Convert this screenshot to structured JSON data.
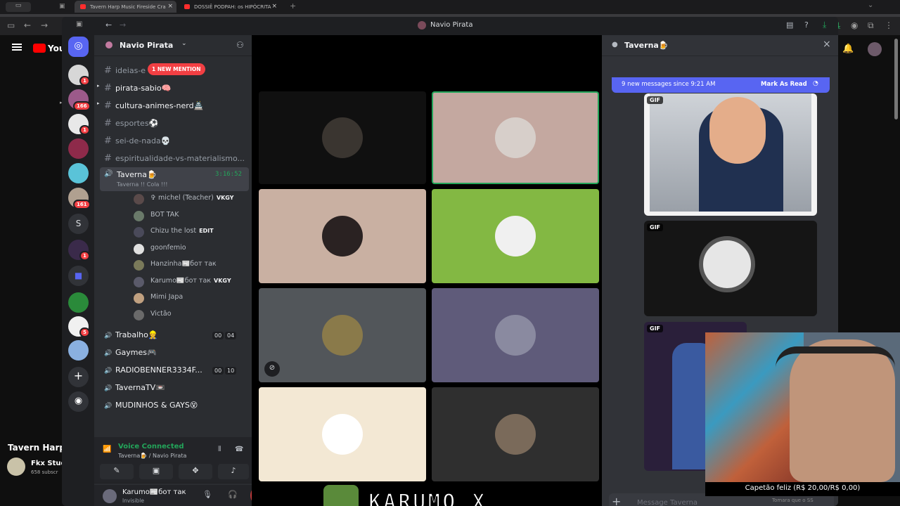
{
  "browser": {
    "tabs": [
      {
        "title": "Tavern Harp Music Fireside Cra",
        "active": true
      },
      {
        "title": "DOSSIÊ PODPAH: os HIPÓCRITA",
        "active": false
      }
    ]
  },
  "youtube": {
    "logo_text": "You",
    "video_title": "Tavern Harp",
    "channel_name": "Fkx Stud",
    "subscribers": "658 subscr"
  },
  "discord": {
    "window_title": "Navio Pirata",
    "server_name": "Navio Pirata",
    "mention_pill": "1 NEW MENTION",
    "channels": [
      {
        "name": "ideias-e",
        "type": "text"
      },
      {
        "name": "pirata-sabio🧠",
        "type": "text",
        "unread": true
      },
      {
        "name": "cultura-animes-nerd🏯",
        "type": "text",
        "unread": true
      },
      {
        "name": "esportes⚽",
        "type": "text"
      },
      {
        "name": "sei-de-nada💀",
        "type": "text"
      },
      {
        "name": "espiritualidade-vs-materialismo...",
        "type": "text"
      }
    ],
    "voice_channel": {
      "name": "Taverna🍺",
      "timer": "3:16:52",
      "status": "Taverna !! Cola !!!"
    },
    "voice_users": [
      {
        "name": "✞ michel (Teacher)",
        "tag": "VKGY"
      },
      {
        "name": "BOT TAK",
        "tag": ""
      },
      {
        "name": "Chizu the lost",
        "tag": "EDIT"
      },
      {
        "name": "goonfemio",
        "tag": ""
      },
      {
        "name": "Hanzinha📰бот так",
        "tag": ""
      },
      {
        "name": "Karumo📰бот так",
        "tag": "VKGY"
      },
      {
        "name": "Mimi Japa",
        "tag": ""
      },
      {
        "name": "Victão",
        "tag": ""
      }
    ],
    "other_voice": [
      {
        "name": "Trabalho👷",
        "c1": "00",
        "c2": "04"
      },
      {
        "name": "Gaymes🎮",
        "c1": "",
        "c2": ""
      },
      {
        "name": "RADIOBENNER3334F...",
        "c1": "00",
        "c2": "10"
      },
      {
        "name": "TavernaTV📼",
        "c1": "",
        "c2": ""
      },
      {
        "name": "MUDINHOS & GAYS😵",
        "c1": "",
        "c2": ""
      }
    ],
    "voice_panel": {
      "status": "Voice Connected",
      "location": "Taverna🍺 / Navio Pirata"
    },
    "user_panel": {
      "name": "Karumo📰бот так",
      "status": "Invisible"
    },
    "guild_badges": [
      "1",
      "166",
      "1",
      "161",
      "1",
      "5"
    ],
    "guild_letter": "S",
    "chat": {
      "title": "Taverna🍺",
      "new_messages": "9 new messages since 9:21 AM",
      "mark_read": "Mark As Read",
      "gif_label": "GIF",
      "placeholder": "Message Taverna"
    },
    "banner_text": "KARUMO_X"
  },
  "overlay": {
    "price": "Capetão feliz (R$ 20,00/R$ 0,00)",
    "bottom_text": "Tomara que o SS"
  }
}
